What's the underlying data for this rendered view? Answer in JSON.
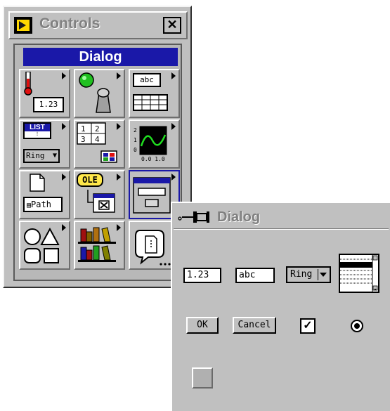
{
  "palette": {
    "title": "Controls",
    "close_label": "✕",
    "subpalette_title": "Dialog",
    "cells": {
      "numeric_value": "1.23",
      "string_value": "abc",
      "list_label": "LIST",
      "ring_label": "Ring",
      "array_nums": [
        "1",
        "2",
        "3",
        "4"
      ],
      "graph_ticks": [
        "2",
        "1",
        "0",
        "0.0",
        "1.0"
      ],
      "path_label": "Path",
      "ole_label": "OLE"
    }
  },
  "dialog": {
    "title": "Dialog",
    "numeric_value": "1.23",
    "string_value": "abc",
    "ring_value": "Ring",
    "ok_label": "OK",
    "cancel_label": "Cancel",
    "checkbox_checked": true,
    "radio_selected": true
  },
  "colors": {
    "face": "#c0c0c0",
    "title_blue": "#1a18a8",
    "text_gray": "#808080"
  }
}
